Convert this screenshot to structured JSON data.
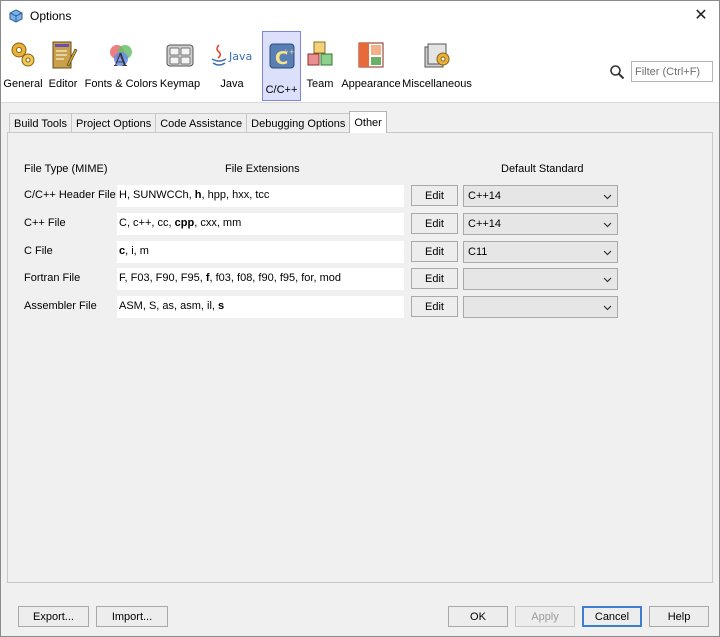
{
  "window": {
    "title": "Options",
    "close_glyph": "✕"
  },
  "categories": [
    {
      "label": "General",
      "icon": "gears-icon"
    },
    {
      "label": "Editor",
      "icon": "editor-icon"
    },
    {
      "label": "Fonts & Colors",
      "icon": "fonts-colors-icon"
    },
    {
      "label": "Keymap",
      "icon": "keyboard-icon"
    },
    {
      "label": "Java",
      "icon": "java-icon"
    },
    {
      "label": "C/C++",
      "icon": "cpp-icon",
      "selected": true
    },
    {
      "label": "Team",
      "icon": "team-cubes-icon"
    },
    {
      "label": "Appearance",
      "icon": "appearance-icon"
    },
    {
      "label": "Miscellaneous",
      "icon": "misc-icon"
    }
  ],
  "search": {
    "placeholder": "Filter (Ctrl+F)"
  },
  "tabs": [
    {
      "label": "Build Tools"
    },
    {
      "label": "Project Options"
    },
    {
      "label": "Code Assistance"
    },
    {
      "label": "Debugging Options"
    },
    {
      "label": "Other",
      "active": true
    }
  ],
  "table": {
    "headers": {
      "file_type": "File Type (MIME)",
      "extensions": "File Extensions",
      "standard": "Default Standard"
    },
    "rows": [
      {
        "file_type": "C/C++ Header File",
        "extensions": [
          [
            "H, SUNWCCh, ",
            false
          ],
          [
            "h",
            true
          ],
          [
            ", hpp, hxx, tcc",
            false
          ]
        ],
        "edit": "Edit",
        "standard": "C++14"
      },
      {
        "file_type": "C++ File",
        "extensions": [
          [
            "C, c++, cc, ",
            false
          ],
          [
            "cpp",
            true
          ],
          [
            ", cxx, mm",
            false
          ]
        ],
        "edit": "Edit",
        "standard": "C++14"
      },
      {
        "file_type": "C File",
        "extensions": [
          [
            "c",
            true
          ],
          [
            ", i, m",
            false
          ]
        ],
        "edit": "Edit",
        "standard": "C11"
      },
      {
        "file_type": "Fortran File",
        "extensions": [
          [
            "F, F03, F90, F95, ",
            false
          ],
          [
            "f",
            true
          ],
          [
            ", f03, f08, f90, f95, for, mod",
            false
          ]
        ],
        "edit": "Edit",
        "standard": ""
      },
      {
        "file_type": "Assembler File",
        "extensions": [
          [
            "ASM, S, as, asm, il, ",
            false
          ],
          [
            "s",
            true
          ]
        ],
        "edit": "Edit",
        "standard": ""
      }
    ]
  },
  "footer": {
    "export": "Export...",
    "import": "Import...",
    "ok": "OK",
    "apply": "Apply",
    "cancel": "Cancel",
    "help": "Help"
  }
}
